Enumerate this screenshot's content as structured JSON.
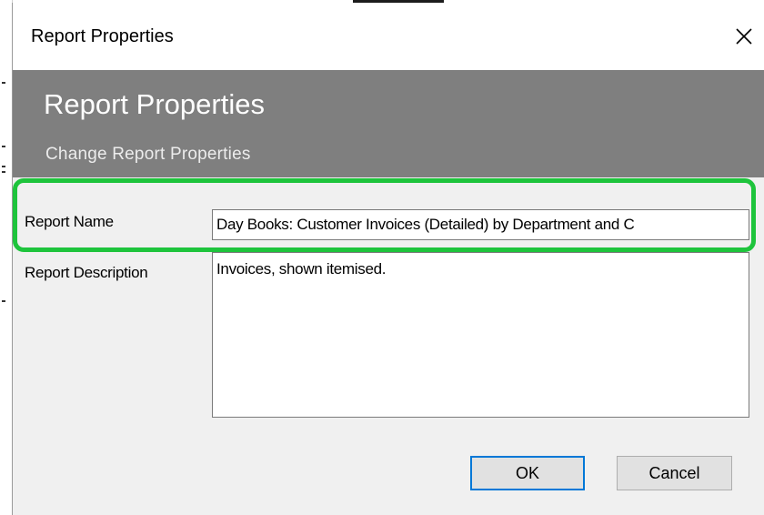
{
  "window": {
    "title": "Report Properties",
    "close_glyph": "✕"
  },
  "header": {
    "title": "Report Properties",
    "subtitle": "Change Report Properties"
  },
  "form": {
    "name_label": "Report Name",
    "name_value": "Day Books: Customer Invoices (Detailed) by Department and C",
    "description_label": "Report Description",
    "description_value": "Invoices, shown itemised."
  },
  "buttons": {
    "ok_label": "OK",
    "cancel_label": "Cancel"
  },
  "colors": {
    "header_bg": "#7f7f7f",
    "highlight": "#1ec43c",
    "default_button_border": "#0078d7"
  },
  "icons": {
    "close": "close-icon"
  }
}
